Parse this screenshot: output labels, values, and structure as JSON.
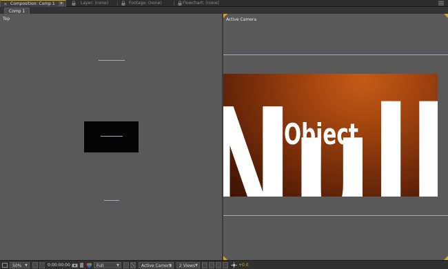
{
  "tabs": {
    "composition": "Composition: Comp 1",
    "layer": "Layer: (none)",
    "footage": "Footage: (none)",
    "flowchart": "Flowchart: (none)"
  },
  "navigator": {
    "comp_crumb": "Comp 1"
  },
  "views": {
    "left_label": "Top",
    "right_label": "Active Camera"
  },
  "render": {
    "big_text": "Null",
    "object_text": "Object",
    "colors": {
      "background_center": "#c55b18",
      "background_edge": "#3b1203",
      "text": "#ffffff"
    }
  },
  "toolbar": {
    "magnification": "50%",
    "timecode": "0:00:00:00",
    "resolution": "Full",
    "view_select": "Active Camera",
    "view_layout": "2 Views",
    "exposure": "+0.0"
  },
  "colors": {
    "accent": "#d9a51d",
    "viewer_bg": "#595959",
    "panel_bg": "#232323"
  },
  "icons": {
    "close": "close-icon",
    "panel_menu": "panel-menu-icon",
    "lock": "lock-icon",
    "snapshot": "camera-icon",
    "color_picker": "rgb-channel-icon",
    "region": "region-of-interest-icon",
    "transparency_grid": "transparency-grid-icon",
    "3d_renderer": "3d-renderer-icon",
    "reset_exposure": "exposure-icon"
  }
}
